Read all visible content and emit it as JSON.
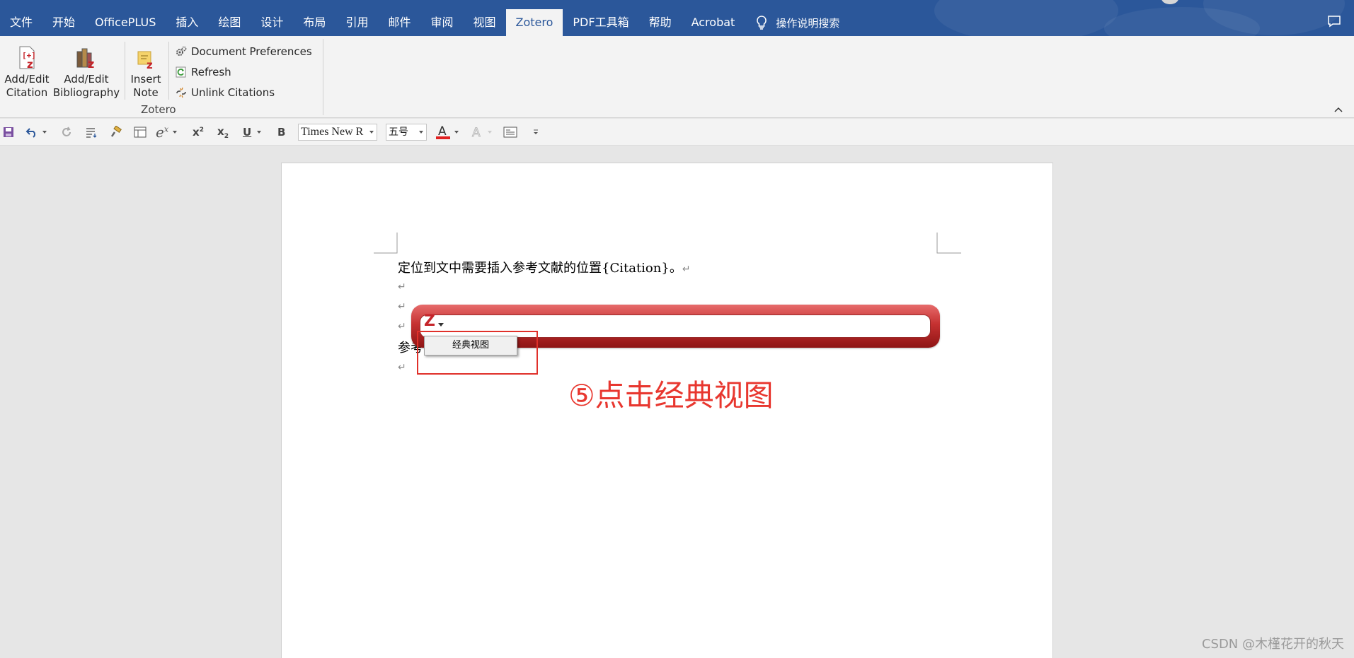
{
  "tabs": [
    {
      "label": "文件",
      "active": false
    },
    {
      "label": "开始",
      "active": false
    },
    {
      "label": "OfficePLUS",
      "active": false
    },
    {
      "label": "插入",
      "active": false
    },
    {
      "label": "绘图",
      "active": false
    },
    {
      "label": "设计",
      "active": false
    },
    {
      "label": "布局",
      "active": false
    },
    {
      "label": "引用",
      "active": false
    },
    {
      "label": "邮件",
      "active": false
    },
    {
      "label": "审阅",
      "active": false
    },
    {
      "label": "视图",
      "active": false
    },
    {
      "label": "Zotero",
      "active": true
    },
    {
      "label": "PDF工具箱",
      "active": false
    },
    {
      "label": "帮助",
      "active": false
    },
    {
      "label": "Acrobat",
      "active": false
    }
  ],
  "search": {
    "label": "操作说明搜索",
    "icon": "lightbulb-icon"
  },
  "ribbon": {
    "add_edit_citation": {
      "line1": "Add/Edit",
      "line2": "Citation"
    },
    "add_edit_bibliography": {
      "line1": "Add/Edit",
      "line2": "Bibliography"
    },
    "insert_note": {
      "line1": "Insert",
      "line2": "Note"
    },
    "document_preferences": "Document Preferences",
    "refresh": "Refresh",
    "unlink_citations": "Unlink Citations",
    "group_label": "Zotero"
  },
  "qat": {
    "font_name": "Times New R",
    "font_size": "五号",
    "font_color": "#e02020"
  },
  "document": {
    "line1": "定位到文中需要插入参考文献的位置{Citation}。",
    "line5": "参考",
    "para_mark": "↵"
  },
  "zotero_bar": {
    "logo": "Z"
  },
  "menu": {
    "item": "经典视图"
  },
  "annotation": {
    "text": "⑤点击经典视图",
    "color": "#e8372f"
  },
  "watermark": "CSDN @木槿花开的秋天",
  "colors": {
    "tab_bar": "#2b579a",
    "ribbon": "#f3f3f3",
    "zotero_red": "#c5242a"
  }
}
